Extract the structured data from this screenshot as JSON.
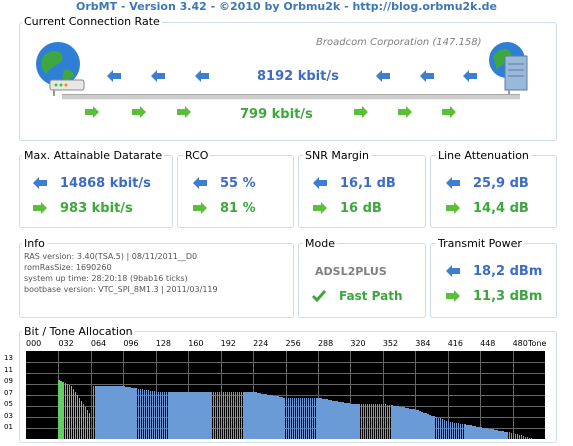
{
  "title": "OrbMT - Version 3.42 - ©2010 by Orbmu2k - http://blog.orbmu2k.de",
  "connection": {
    "legend": "Current Connection Rate",
    "vendor": "Broadcom Corporation (147.158)",
    "downstream": "8192 kbit/s",
    "upstream": "799 kbit/s"
  },
  "attainable": {
    "legend": "Max. Attainable Datarate",
    "down": "14868 kbit/s",
    "up": "983 kbit/s"
  },
  "rco": {
    "legend": "RCO",
    "down": "55 %",
    "up": "81 %"
  },
  "snr": {
    "legend": "SNR Margin",
    "down": "16,1 dB",
    "up": "16 dB"
  },
  "attenuation": {
    "legend": "Line Attenuation",
    "down": "25,9 dB",
    "up": "14,4 dB"
  },
  "info": {
    "legend": "Info",
    "lines": [
      "RAS version: 3.40(TSA.5) | 08/11/2011__D0",
      "romRasSize: 1690260",
      "system up time:    28:20:18 (9bab16 ticks)",
      "bootbase version: VTC_SPI_8M1.3 | 2011/03/119"
    ]
  },
  "mode": {
    "legend": "Mode",
    "value": "ADSL2PLUS",
    "path": "Fast Path"
  },
  "transmit": {
    "legend": "Transmit Power",
    "down": "18,2 dBm",
    "up": "11,3 dBm"
  },
  "chart_data": {
    "type": "bar",
    "title": "Bit / Tone Allocation",
    "xlabel": "Tone",
    "x_ticks": [
      "000",
      "032",
      "064",
      "096",
      "128",
      "160",
      "192",
      "224",
      "256",
      "288",
      "320",
      "352",
      "384",
      "416",
      "448",
      "480"
    ],
    "y_ticks": [
      "13",
      "11",
      "09",
      "07",
      "05",
      "03",
      "01"
    ],
    "ylim": [
      0,
      15
    ],
    "xlim": [
      0,
      511
    ],
    "series": [
      {
        "segments": [
          [
            32,
            10
          ],
          [
            44,
            9
          ],
          [
            56,
            6
          ],
          [
            64,
            4
          ]
        ],
        "color": "#66cc66"
      },
      {
        "segments": [
          [
            66,
            9
          ],
          [
            96,
            9
          ],
          [
            130,
            8
          ],
          [
            160,
            8
          ],
          [
            200,
            8
          ],
          [
            224,
            8
          ],
          [
            256,
            7
          ],
          [
            288,
            7
          ],
          [
            320,
            6
          ],
          [
            352,
            6
          ],
          [
            384,
            5
          ],
          [
            400,
            4
          ],
          [
            416,
            3
          ],
          [
            448,
            2
          ],
          [
            480,
            1
          ],
          [
            500,
            0
          ]
        ],
        "color": "#6b9bd6"
      }
    ],
    "colors": {
      "upstream": "#66cc66",
      "downstream": "#6b9bd6",
      "background": "#000000",
      "grid": "#666666"
    }
  },
  "colors": {
    "accent_blue": "#3c6cc8",
    "accent_green": "#3ca83c",
    "title": "#3c78b4"
  }
}
